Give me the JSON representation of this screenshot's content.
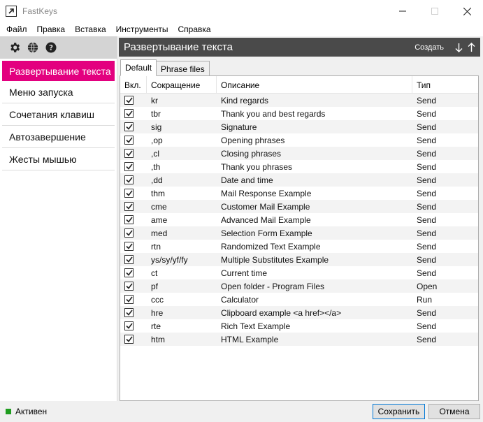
{
  "window": {
    "title": "FastKeys"
  },
  "menu": [
    "Файл",
    "Правка",
    "Вставка",
    "Инструменты",
    "Справка"
  ],
  "sidebar": {
    "tool_icons": [
      "gear-icon",
      "globe-icon",
      "help-icon"
    ],
    "items": [
      {
        "label": "Развертывание текста",
        "active": true
      },
      {
        "label": "Меню запуска",
        "active": false
      },
      {
        "label": "Сочетания клавиш",
        "active": false
      },
      {
        "label": "Автозавершение",
        "active": false
      },
      {
        "label": "Жесты мышью",
        "active": false
      }
    ]
  },
  "main": {
    "title": "Развертывание текста",
    "create_label": "Создать",
    "tabs": [
      {
        "label": "Default",
        "active": true
      },
      {
        "label": "Phrase files",
        "active": false
      }
    ]
  },
  "table": {
    "columns": [
      "Вкл.",
      "Сокращение",
      "Описание",
      "Тип"
    ],
    "rows": [
      {
        "enabled": true,
        "abbr": "kr",
        "desc": "Kind regards",
        "type": "Send"
      },
      {
        "enabled": true,
        "abbr": "tbr",
        "desc": "Thank you and best regards",
        "type": "Send"
      },
      {
        "enabled": true,
        "abbr": "sig",
        "desc": "Signature",
        "type": "Send"
      },
      {
        "enabled": true,
        "abbr": ",op",
        "desc": "Opening phrases",
        "type": "Send"
      },
      {
        "enabled": true,
        "abbr": ",cl",
        "desc": "Closing phrases",
        "type": "Send"
      },
      {
        "enabled": true,
        "abbr": ",th",
        "desc": "Thank you phrases",
        "type": "Send"
      },
      {
        "enabled": true,
        "abbr": ",dd",
        "desc": "Date and time",
        "type": "Send"
      },
      {
        "enabled": true,
        "abbr": "thm",
        "desc": "Mail Response Example",
        "type": "Send"
      },
      {
        "enabled": true,
        "abbr": "cme",
        "desc": "Customer Mail Example",
        "type": "Send"
      },
      {
        "enabled": true,
        "abbr": "ame",
        "desc": "Advanced Mail Example",
        "type": "Send"
      },
      {
        "enabled": true,
        "abbr": "med",
        "desc": "Selection Form Example",
        "type": "Send"
      },
      {
        "enabled": true,
        "abbr": "rtn",
        "desc": "Randomized Text Example",
        "type": "Send"
      },
      {
        "enabled": true,
        "abbr": "ys/sy/yf/fy",
        "desc": "Multiple Substitutes Example",
        "type": "Send"
      },
      {
        "enabled": true,
        "abbr": "ct",
        "desc": "Current time",
        "type": "Send"
      },
      {
        "enabled": true,
        "abbr": "pf",
        "desc": "Open folder - Program Files",
        "type": "Open"
      },
      {
        "enabled": true,
        "abbr": "ccc",
        "desc": "Calculator",
        "type": "Run"
      },
      {
        "enabled": true,
        "abbr": "hre",
        "desc": "Clipboard example <a href></a>",
        "type": "Send"
      },
      {
        "enabled": true,
        "abbr": "rte",
        "desc": "Rich Text Example",
        "type": "Send"
      },
      {
        "enabled": true,
        "abbr": "htm",
        "desc": "HTML Example",
        "type": "Send"
      }
    ]
  },
  "status": {
    "text": "Активен",
    "color": "#1f9d1f"
  },
  "footer": {
    "save_label": "Сохранить",
    "cancel_label": "Отмена"
  },
  "colors": {
    "accent": "#e3007f",
    "header_bg": "#4a4a4a"
  }
}
